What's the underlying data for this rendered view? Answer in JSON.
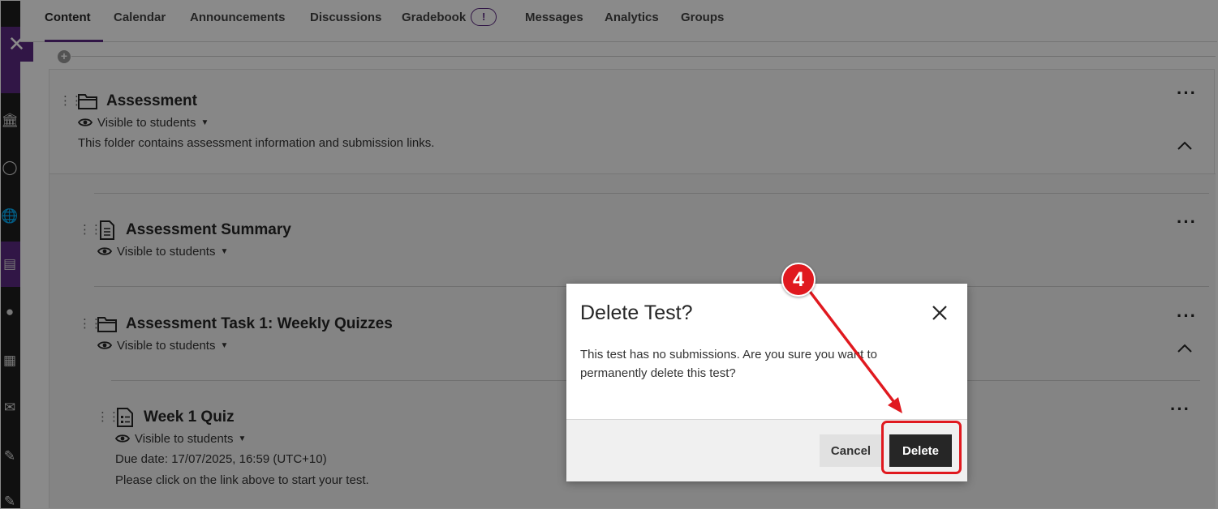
{
  "nav": {
    "tabs": [
      {
        "label": "Content",
        "active": true
      },
      {
        "label": "Calendar"
      },
      {
        "label": "Announcements"
      },
      {
        "label": "Discussions"
      },
      {
        "label": "Gradebook",
        "badge": "!"
      },
      {
        "label": "Messages"
      },
      {
        "label": "Analytics"
      },
      {
        "label": "Groups"
      }
    ]
  },
  "folder": {
    "title": "Assessment",
    "visibility": "Visible to students",
    "description": "This folder contains assessment information and submission links."
  },
  "items": [
    {
      "title": "Assessment Summary",
      "visibility": "Visible to students"
    },
    {
      "title": "Assessment Task 1: Weekly Quizzes",
      "visibility": "Visible to students"
    }
  ],
  "quiz": {
    "title": "Week 1 Quiz",
    "visibility": "Visible to students",
    "due_date": "Due date: 17/07/2025, 16:59 (UTC+10)",
    "instructions": "Please click on the link above to start your test."
  },
  "dialog": {
    "title": "Delete Test?",
    "body": "This test has no submissions. Are you sure you want to permanently delete this test?",
    "cancel_label": "Cancel",
    "delete_label": "Delete"
  },
  "annotation": {
    "step": "4",
    "color": "#e0191f"
  },
  "colors": {
    "accent": "#5c2a82",
    "primary_button": "#262626"
  }
}
